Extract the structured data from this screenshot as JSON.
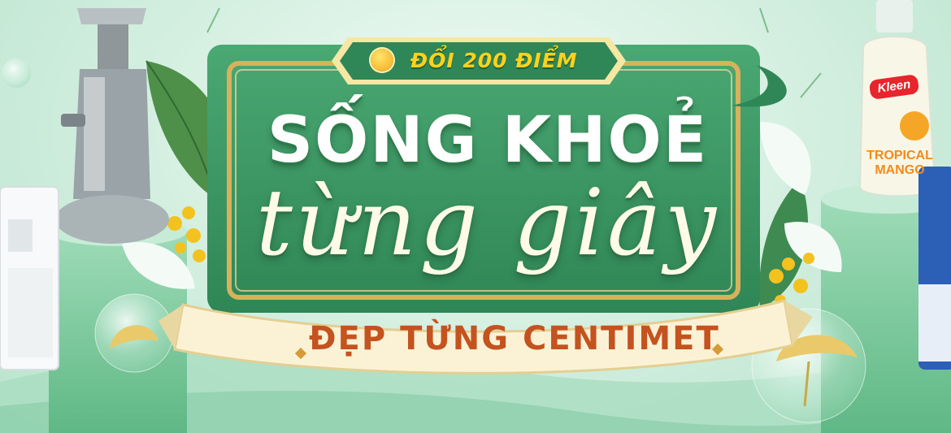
{
  "badge": {
    "text": "ĐỔI 200 ĐIỂM"
  },
  "headline": {
    "line1": "SỐNG KHOẺ",
    "line2": "từng giây"
  },
  "subtitle": {
    "text": "ĐẸP TỪNG CENTIMET"
  },
  "product_right": {
    "brand": "Kleen",
    "flavor_line1": "TROPICAL",
    "flavor_line2": "MANGO"
  },
  "colors": {
    "panel_green": "#3f9a64",
    "gold": "#d7b15b",
    "badge_text": "#ffd21a",
    "subtitle_text": "#c4531f",
    "ribbon": "#fbf2d6"
  }
}
